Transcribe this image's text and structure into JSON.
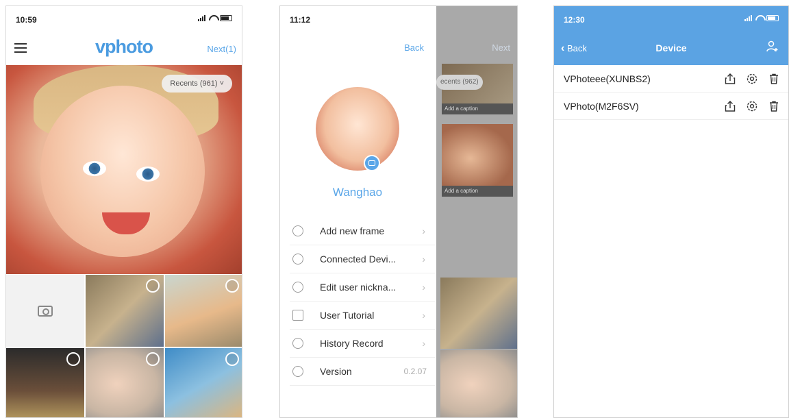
{
  "phone1": {
    "status_time": "10:59",
    "logo": "vphoto",
    "next_label": "Next(1)",
    "recents_label": "Recents (961) ˅"
  },
  "phone2": {
    "status_time": "11:12",
    "back_label": "Back",
    "next_label": "Next",
    "username": "Wanghao",
    "menu": [
      {
        "icon": "user-icon",
        "label": "Add new frame",
        "value": ""
      },
      {
        "icon": "connected-devices-icon",
        "label": "Connected Devi...",
        "value": ""
      },
      {
        "icon": "edit-user-icon",
        "label": "Edit user nickna...",
        "value": ""
      },
      {
        "icon": "document-icon",
        "label": "User Tutorial",
        "value": ""
      },
      {
        "icon": "clock-icon",
        "label": "History Record",
        "value": ""
      },
      {
        "icon": "info-icon",
        "label": "Version",
        "value": "0.2.07"
      }
    ],
    "bg_recents": "ecents (962)",
    "bg_caption": "Add a caption"
  },
  "phone3": {
    "status_time": "12:30",
    "back_label": "Back",
    "title": "Device",
    "devices": [
      {
        "name": "VPhoteee(XUNBS2)"
      },
      {
        "name": "VPhoto(M2F6SV)"
      }
    ]
  },
  "colors": {
    "accent": "#5aa6e8",
    "header_blue": "#5ba3e3"
  }
}
